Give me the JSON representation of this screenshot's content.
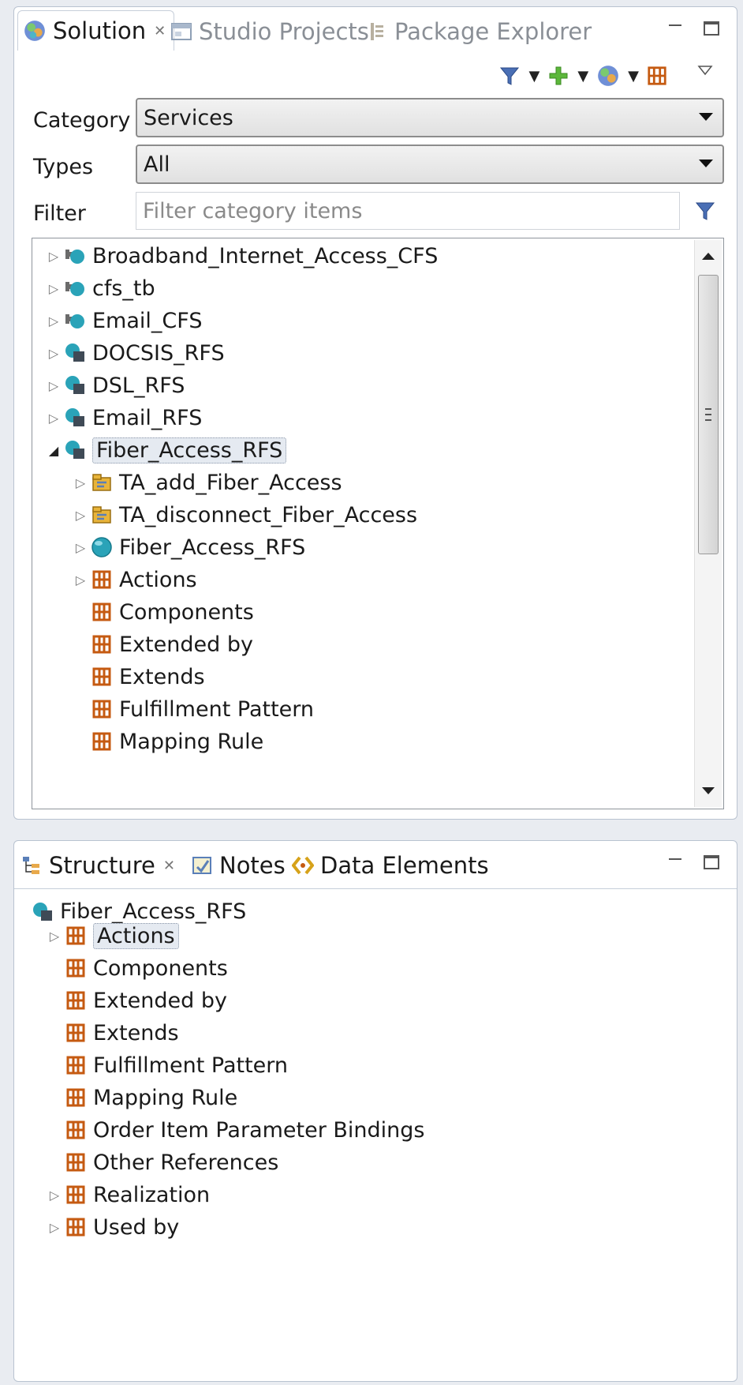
{
  "top_panel": {
    "tabs": [
      {
        "label": "Solution",
        "close": "✕",
        "icon": "solution-icon",
        "active": true
      },
      {
        "label": "Studio Projects",
        "icon": "studio-projects-icon",
        "active": false
      },
      {
        "label": "Package Explorer",
        "icon": "package-explorer-icon",
        "active": false
      }
    ],
    "category": {
      "label": "Category",
      "value": "Services"
    },
    "types": {
      "label": "Types",
      "value": "All"
    },
    "filter": {
      "label": "Filter",
      "placeholder": "Filter category items"
    },
    "tree": [
      {
        "label": "Broadband_Internet_Access_CFS",
        "icon": "cfs-icon",
        "expander": "▷",
        "level": 0
      },
      {
        "label": "cfs_tb",
        "icon": "cfs-icon",
        "expander": "▷",
        "level": 0
      },
      {
        "label": "Email_CFS",
        "icon": "cfs-icon",
        "expander": "▷",
        "level": 0
      },
      {
        "label": "DOCSIS_RFS",
        "icon": "rfs-icon",
        "expander": "▷",
        "level": 0
      },
      {
        "label": "DSL_RFS",
        "icon": "rfs-icon",
        "expander": "▷",
        "level": 0
      },
      {
        "label": "Email_RFS",
        "icon": "rfs-icon",
        "expander": "▷",
        "level": 0
      },
      {
        "label": "Fiber_Access_RFS",
        "icon": "rfs-icon",
        "expander": "◢",
        "level": 0,
        "selected": true
      },
      {
        "label": "TA_add_Fiber_Access",
        "icon": "technical-action-icon",
        "expander": "▷",
        "level": 1
      },
      {
        "label": "TA_disconnect_Fiber_Access",
        "icon": "technical-action-icon",
        "expander": "▷",
        "level": 1
      },
      {
        "label": "Fiber_Access_RFS",
        "icon": "globe-icon",
        "expander": "▷",
        "level": 1
      },
      {
        "label": "Actions",
        "icon": "folder-grid-icon",
        "expander": "▷",
        "level": 1
      },
      {
        "label": "Components",
        "icon": "folder-grid-icon",
        "expander": "",
        "level": 1
      },
      {
        "label": "Extended by",
        "icon": "folder-grid-icon",
        "expander": "",
        "level": 1
      },
      {
        "label": "Extends",
        "icon": "folder-grid-icon",
        "expander": "",
        "level": 1
      },
      {
        "label": "Fulfillment Pattern",
        "icon": "folder-grid-icon",
        "expander": "",
        "level": 1
      },
      {
        "label": "Mapping Rule",
        "icon": "folder-grid-icon",
        "expander": "",
        "level": 1
      }
    ]
  },
  "bottom_panel": {
    "tabs": [
      {
        "label": "Structure",
        "close": "✕",
        "icon": "structure-icon",
        "active": true
      },
      {
        "label": "Notes",
        "icon": "notes-icon",
        "active": false
      },
      {
        "label": "Data Elements",
        "icon": "data-elements-icon",
        "active": false
      }
    ],
    "root": {
      "label": "Fiber_Access_RFS",
      "icon": "rfs-icon"
    },
    "items": [
      {
        "label": "Actions",
        "expander": "▷",
        "focused": true
      },
      {
        "label": "Components",
        "expander": ""
      },
      {
        "label": "Extended by",
        "expander": ""
      },
      {
        "label": "Extends",
        "expander": ""
      },
      {
        "label": "Fulfillment Pattern",
        "expander": ""
      },
      {
        "label": "Mapping Rule",
        "expander": ""
      },
      {
        "label": "Order Item Parameter Bindings",
        "expander": ""
      },
      {
        "label": "Other References",
        "expander": ""
      },
      {
        "label": "Realization",
        "expander": "▷"
      },
      {
        "label": "Used by",
        "expander": "▷"
      }
    ]
  },
  "colors": {
    "background": "#e9ecf1",
    "panel": "#ffffff",
    "folder_icon": "#c55a11",
    "globe": "#2aa3b8",
    "selection": "#e5eaf1"
  }
}
